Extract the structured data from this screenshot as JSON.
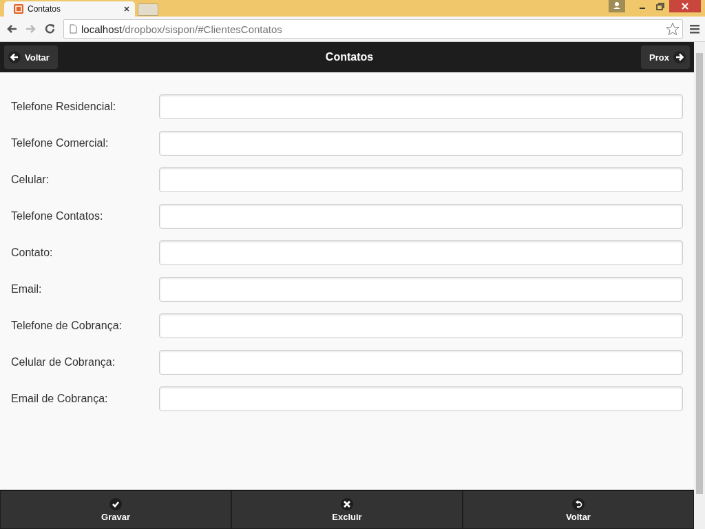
{
  "browser": {
    "tab_title": "Contatos",
    "url_host": "localhost",
    "url_path": "/dropbox/sispon/#ClientesContatos"
  },
  "header": {
    "back_label": "Voltar",
    "title": "Contatos",
    "next_label": "Prox"
  },
  "fields": [
    {
      "label": "Telefone Residencial:"
    },
    {
      "label": "Telefone Comercial:"
    },
    {
      "label": "Celular:"
    },
    {
      "label": "Telefone Contatos:"
    },
    {
      "label": "Contato:"
    },
    {
      "label": "Email:"
    },
    {
      "label": "Telefone de Cobrança:"
    },
    {
      "label": "Celular de Cobrança:"
    },
    {
      "label": "Email de Cobrança:"
    }
  ],
  "footer": [
    {
      "kind": "save",
      "label": "Gravar"
    },
    {
      "kind": "delete",
      "label": "Excluir"
    },
    {
      "kind": "back",
      "label": "Voltar"
    }
  ]
}
